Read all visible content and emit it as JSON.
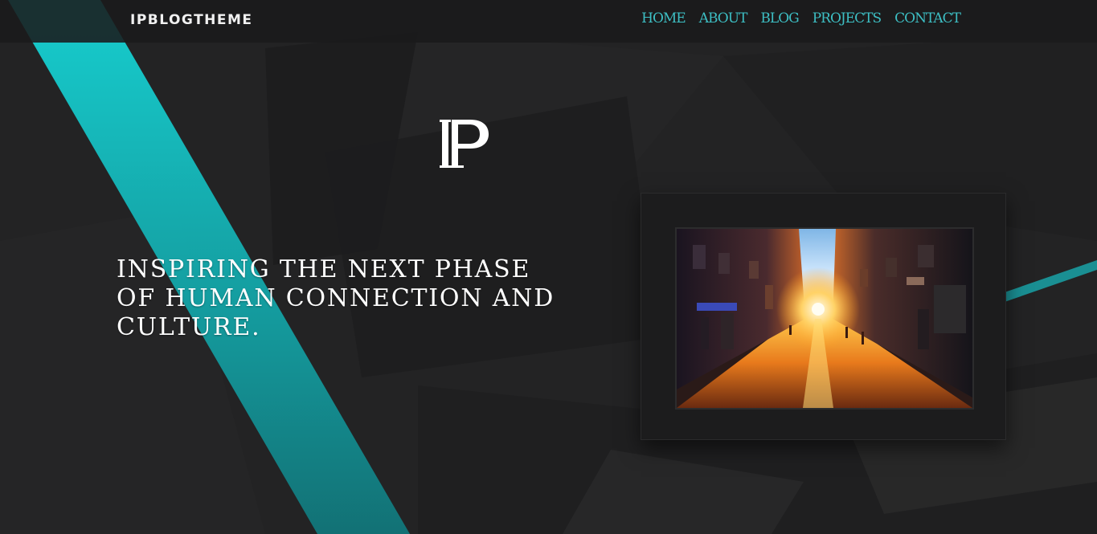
{
  "header": {
    "brand": "IPBLOGTHEME",
    "nav": {
      "home": "HOME",
      "about": "ABOUT",
      "blog": "BLOG",
      "projects": "PROJECTS",
      "contact": "CONTACT"
    }
  },
  "hero": {
    "logo_letter": "P",
    "headline": "INSPIRING THE NEXT PHASE OF HUMAN CONNECTION AND CULTURE."
  },
  "colors": {
    "accent": "#3dbfc4",
    "stripe": "#16d6d8",
    "background": "#232324",
    "text": "#ffffff"
  },
  "icons": {
    "logo": "ip-monogram-logo"
  },
  "picture": {
    "subject": "sunset-city-street-photo"
  }
}
